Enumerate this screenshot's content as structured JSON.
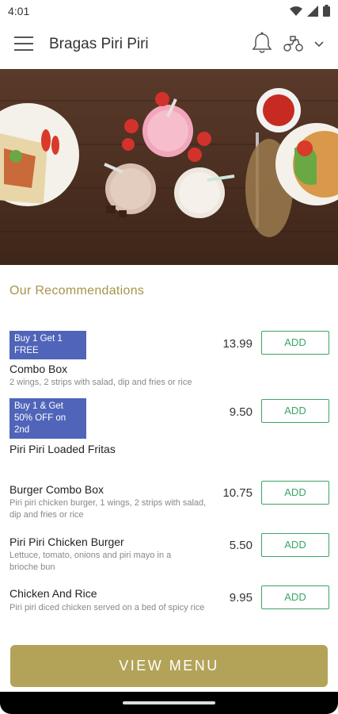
{
  "status": {
    "time": "4:01"
  },
  "app_bar": {
    "title": "Bragas Piri Piri"
  },
  "section": {
    "heading": "Our Recommendations"
  },
  "items": [
    {
      "promo": "Buy 1 Get 1 FREE",
      "name": "Combo Box",
      "description": "2 wings, 2 strips with salad, dip and fries or rice",
      "price": "13.99",
      "add_label": "ADD"
    },
    {
      "promo": "Buy 1 & Get 50% OFF on 2nd",
      "name": "Piri Piri Loaded Fritas",
      "description": "",
      "price": "9.50",
      "add_label": "ADD"
    },
    {
      "promo": "",
      "name": "Burger Combo Box",
      "description": "Piri piri chicken burger, 1 wings, 2 strips with salad, dip and fries or rice",
      "price": "10.75",
      "add_label": "ADD"
    },
    {
      "promo": "",
      "name": "Piri Piri Chicken Burger",
      "description": "Lettuce, tomato, onions and piri mayo in a brioche bun",
      "price": "5.50",
      "add_label": "ADD"
    },
    {
      "promo": "",
      "name": "Chicken And Rice",
      "description": "Piri piri diced chicken served on a bed of spicy rice",
      "price": "9.95",
      "add_label": "ADD"
    }
  ],
  "footer": {
    "view_menu_label": "VIEW MENU"
  },
  "colors": {
    "accent": "#b3a358",
    "heading": "#a8944a",
    "add_green": "#3aa565",
    "promo_blue": "#5064b9",
    "hero_wood": "#4a2e20"
  },
  "icons": [
    "wifi-icon",
    "signal-icon",
    "battery-icon",
    "menu-icon",
    "bell-icon",
    "scooter-icon",
    "chevron-down-icon"
  ]
}
